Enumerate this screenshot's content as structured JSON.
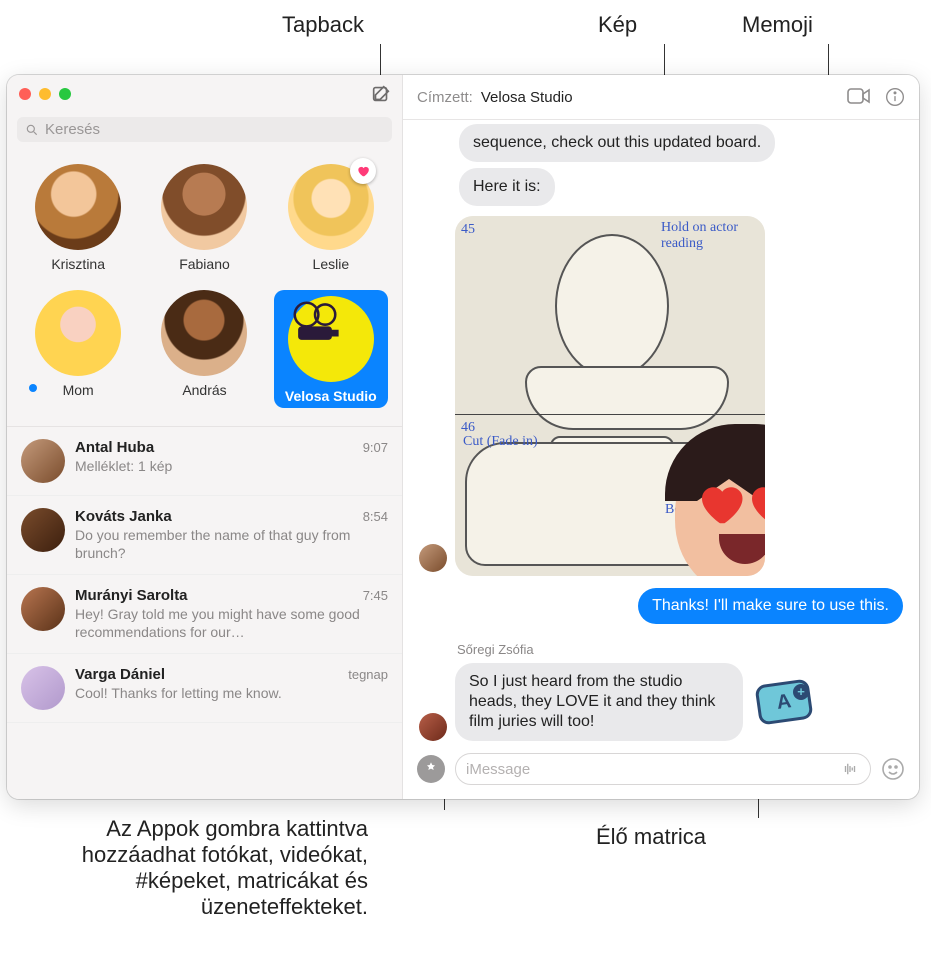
{
  "callouts": {
    "tapback": "Tapback",
    "image": "Kép",
    "memoji": "Memoji",
    "apps": "Az Appok gombra kattintva hozzáadhat fotókat, videókat, #képeket, matricákat és üzeneteffekteket.",
    "sticker": "Élő matrica"
  },
  "sidebar": {
    "search_placeholder": "Keresés",
    "pinned": [
      {
        "name": "Krisztina"
      },
      {
        "name": "Fabiano"
      },
      {
        "name": "Leslie"
      },
      {
        "name": "Mom"
      },
      {
        "name": "András"
      },
      {
        "name": "Velosa Studio"
      }
    ],
    "conversations": [
      {
        "name": "Antal Huba",
        "time": "9:07",
        "preview": "Melléklet: 1 kép"
      },
      {
        "name": "Kováts Janka",
        "time": "8:54",
        "preview": "Do you remember the name of that guy from brunch?"
      },
      {
        "name": "Murányi Sarolta",
        "time": "7:45",
        "preview": "Hey! Gray told me you might have some good recommendations for our…"
      },
      {
        "name": "Varga Dániel",
        "time": "tegnap",
        "preview": "Cool! Thanks for letting me know."
      }
    ]
  },
  "header": {
    "to_label": "Címzett:",
    "recipient": "Velosa Studio"
  },
  "thread": {
    "msg1": "sequence, check out this updated board.",
    "msg2": "Here it is:",
    "image_notes": {
      "n1": "45",
      "n2": "Hold on actor reading",
      "n3": "Cut (Fade in)",
      "n4": "Dialog Begins Here",
      "n5": "46"
    },
    "outgoing1": "Thanks! I'll make sure to use this.",
    "sender2": "Sőregi Zsófia",
    "msg3": "So I just heard from the studio heads, they LOVE it and they think film juries will too!",
    "sticker_text": "A"
  },
  "compose": {
    "placeholder": "iMessage"
  }
}
